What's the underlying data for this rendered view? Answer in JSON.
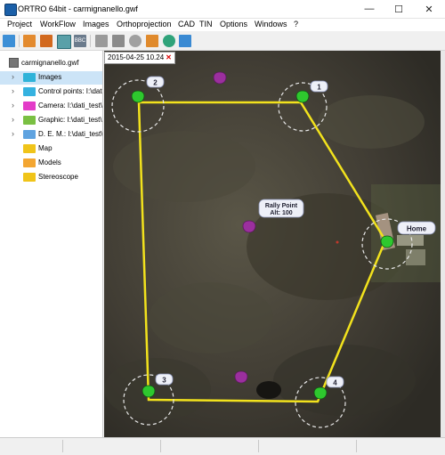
{
  "window": {
    "title": "ORTRO 64bit - carmignanello.gwf",
    "minimize_glyph": "—",
    "maximize_glyph": "☐",
    "close_glyph": "✕"
  },
  "menu": [
    "Project",
    "WorkFlow",
    "Images",
    "Orthoprojection",
    "CAD",
    "TIN",
    "Options",
    "Windows",
    "?"
  ],
  "toolbar": {
    "icons": [
      "open-folder-icon",
      "image-icon",
      "image-alt-icon",
      "play-icon",
      "bbc-icon",
      "gray-box-icon",
      "chart-icon",
      "grid-icon",
      "tools-icon",
      "eye-icon",
      "panel-icon"
    ],
    "bbc_label": "BBC"
  },
  "sidebar": {
    "root_label": "carmignanello.gwf",
    "items": [
      {
        "label": "Images",
        "icon": "images-folder-icon",
        "expandable": true,
        "selected": true
      },
      {
        "label": "Control points: I:\\dati_test\\C",
        "icon": "control-points-folder-icon",
        "expandable": true,
        "selected": false
      },
      {
        "label": "Camera: I:\\dati_test\\Car",
        "icon": "camera-folder-icon",
        "expandable": true,
        "selected": false
      },
      {
        "label": "Graphic: I:\\dati_test\\Car",
        "icon": "graphic-folder-icon",
        "expandable": true,
        "selected": false
      },
      {
        "label": "D. E. M.: I:\\dati_test\\Ca",
        "icon": "dem-folder-icon",
        "expandable": true,
        "selected": false
      },
      {
        "label": "Map",
        "icon": "map-folder-icon",
        "expandable": false,
        "selected": false
      },
      {
        "label": "Models",
        "icon": "models-folder-icon",
        "expandable": false,
        "selected": false
      },
      {
        "label": "Stereoscope",
        "icon": "stereoscope-folder-icon",
        "expandable": false,
        "selected": false
      }
    ]
  },
  "map": {
    "tab_label": "2015-04-25 10.24",
    "tab_close": "✕",
    "rally_point_line1": "Rally Point",
    "rally_point_line2": "Alt: 100",
    "home_label": "Home",
    "waypoints": [
      "1",
      "2",
      "3",
      "4"
    ],
    "colors": {
      "path": "#f2e21d",
      "waypoint_marker": "#2ec82e",
      "rally_marker": "#9b2f9e",
      "label_bg": "#eef0f8"
    }
  }
}
